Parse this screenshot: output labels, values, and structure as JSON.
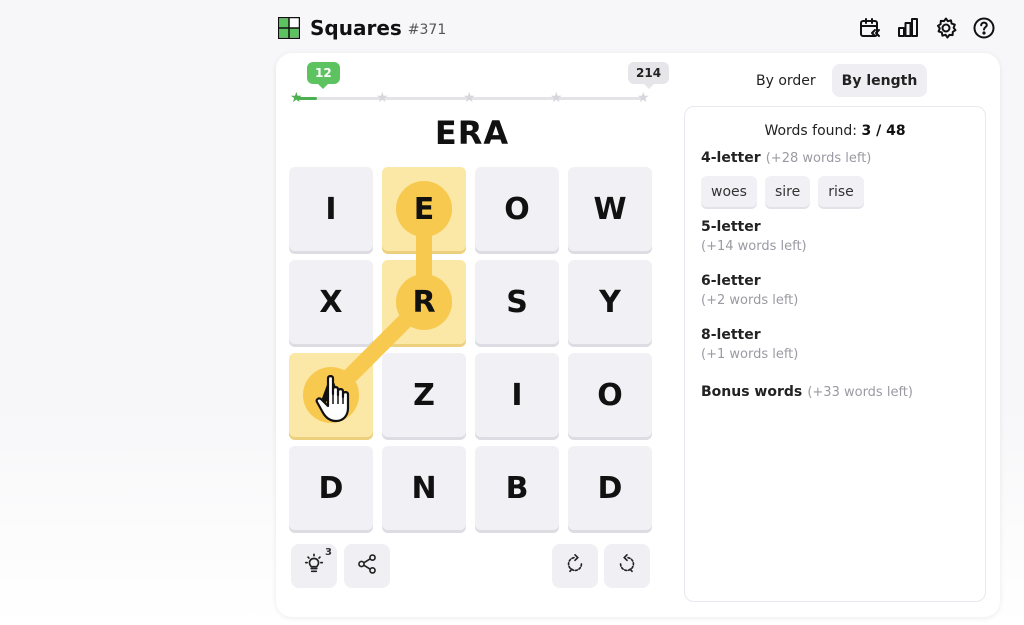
{
  "header": {
    "title": "Squares",
    "puzzle_number": "#371",
    "icons": [
      "calendar-archive-icon",
      "stats-icon",
      "settings-icon",
      "help-icon"
    ]
  },
  "progress": {
    "current_score": "12",
    "max_score": "214",
    "fraction": 0.056
  },
  "current_word": "ERA",
  "grid": {
    "rows": [
      [
        "I",
        "E",
        "O",
        "W"
      ],
      [
        "X",
        "R",
        "S",
        "Y"
      ],
      [
        "A",
        "Z",
        "I",
        "O"
      ],
      [
        "D",
        "N",
        "B",
        "D"
      ]
    ],
    "selected_path": [
      [
        0,
        1
      ],
      [
        1,
        1
      ],
      [
        2,
        0
      ]
    ]
  },
  "controls": {
    "hint_count": "3"
  },
  "view_toggle": {
    "by_order": "By order",
    "by_length": "By length",
    "active": "by_length"
  },
  "words_panel": {
    "found_label": "Words found:",
    "found_value": "3 / 48",
    "groups": [
      {
        "label": "4-letter",
        "left": "(+28 words left)",
        "words": [
          "woes",
          "sire",
          "rise"
        ]
      },
      {
        "label": "5-letter",
        "left": "(+14 words left)"
      },
      {
        "label": "6-letter",
        "left": "(+2 words left)"
      },
      {
        "label": "8-letter",
        "left": "(+1 words left)"
      },
      {
        "label": "Bonus words",
        "left": "(+33 words left)"
      }
    ]
  },
  "colors": {
    "accent_green": "#5cc360",
    "selected_tile": "#fbe7a6",
    "selected_dot": "#f7c94f"
  }
}
